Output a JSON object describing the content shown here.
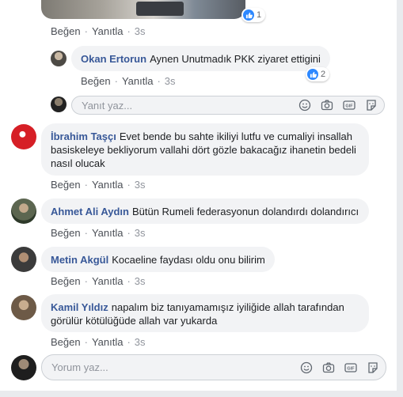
{
  "labels": {
    "like": "Beğen",
    "reply": "Yanıtla",
    "separator": "·"
  },
  "top_post": {
    "time": "3s",
    "reactions": "1"
  },
  "reply_thread": {
    "comment": {
      "author": "Okan Ertorun",
      "text": "Aynen Unutmadık PKK ziyaret ettigini",
      "time": "3s",
      "reactions": "2"
    },
    "reply_box": {
      "placeholder": "Yanıt yaz..."
    }
  },
  "comments": [
    {
      "author": "İbrahim Taşçı",
      "text": "Evet bende bu sahte ikiliyi lutfu ve cumaliyi insallah basiskeleye bekliyorum vallahi dört gözle bakacağız ihanetin bedeli nasıl olucak",
      "time": "3s"
    },
    {
      "author": "Ahmet Ali Aydın",
      "text": "Bütün Rumeli federasyonun dolandırdı dolandırıcı",
      "time": "3s"
    },
    {
      "author": "Metin Akgül",
      "text": "Kocaeline faydası oldu onu bilirim",
      "time": "3s"
    },
    {
      "author": "Kamil Yıldız",
      "text": "napalım biz tanıyamamışız iyiliğide allah tarafından görülür kötülüğüde allah var yukarda",
      "time": "3s"
    }
  ],
  "comment_box": {
    "placeholder": "Yorum yaz..."
  },
  "colors": {
    "link": "#385898",
    "bubble": "#f2f3f5",
    "like_blue": "#2d88ff",
    "meta": "#90949c"
  }
}
